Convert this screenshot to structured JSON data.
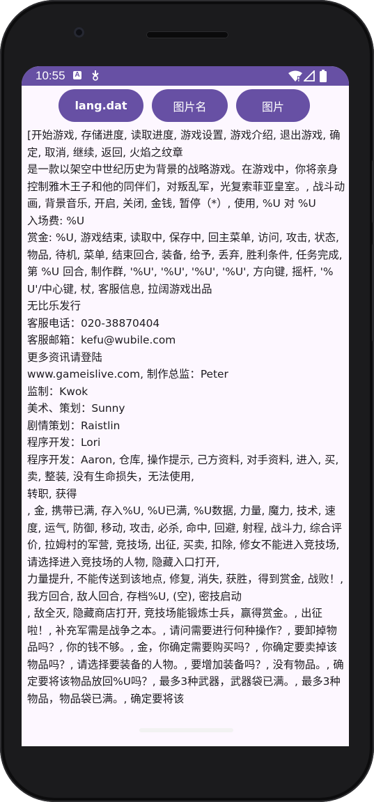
{
  "status_bar": {
    "time": "10:55",
    "icons": [
      "notification-a-icon",
      "data-saver-icon",
      "wifi-icon",
      "cell-signal-icon",
      "battery-icon"
    ]
  },
  "toolbar": {
    "lang_button": "lang.dat",
    "image_name_button": "图片名",
    "image_button": "图片"
  },
  "content": {
    "text": "[开始游戏, 存储进度, 读取进度, 游戏设置, 游戏介绍, 退出游戏, 确定, 取消, 继续, 返回, 火焰之纹章\n是一款以架空中世纪历史为背景的战略游戏。在游戏中，你将亲身控制雅木王子和他的同伴们，对叛乱军，光复索菲亚皇室。, 战斗动画, 背景音乐, 开启, 关闭, 金钱, 暂停（*）, 使用, %U 对 %U\n入场费: %U\n赏金: %U, 游戏结束, 读取中, 保存中, 回主菜单, 访问, 攻击, 状态, 物品, 待机, 菜单, 结束回合, 装备, 给予, 丢弃, 胜利条件, 任务完成, 第 %U 回合, 制作群, '%U', '%U', '%U', '%U', 方向键, 摇杆, '%U'/中心键, 杖, 客服信息, 拉阔游戏出品\n无比乐发行\n客服电话：020-38870404\n客服邮箱：kefu@wubile.com\n更多资讯请登陆\nwww.gameislive.com, 制作总监：Peter\n监制：Kwok\n美术、策划：Sunny\n剧情策划：Raistlin\n程序开发：Lori\n程序开发：Aaron, 仓库, 操作提示, 己方资料, 对手资料, 进入, 买, 卖, 整装, 没有生命损失，无法使用,\n转职, 获得\n, 金, 携带已满, 存入%U, %U已满, %U数据, 力量, 魔力, 技术, 速度, 运气, 防御, 移动, 攻击, 必杀, 命中, 回避, 射程, 战斗力, 综合评价, 拉姆村的军营, 竞技场, 出征, 买卖, 扣除, 修女不能进入竞技场, 请选择进入竞技场的人物, 隐藏入口打开,\n力量提升, 不能传送到该地点, 修复, 消失, 获胜，得到赏金, 战败！, 我方回合, 敌人回合, 存档%U, (空), 密技启动\n, 敌全灭, 隐藏商店打开, 竞技场能锻炼士兵，赢得赏金。, 出征啦！, 补充军需是战争之本。, 请问需要进行何种操作？, 要卸掉物品吗？, 你的钱不够。, 金，你确定需要购买吗？, 你确定要卖掉该物品吗？, 请选择要装备的人物。, 要增加装备吗？, 没有物品。, 确定要将该物品放回%U吗？, 最多3种武器，武器袋已满。, 最多3种物品，物品袋已满。, 确定要将该"
  },
  "colors": {
    "accent": "#6750a4",
    "background": "#fdf7ff",
    "text": "#1d1b20",
    "frame": "#1b1b1d"
  }
}
